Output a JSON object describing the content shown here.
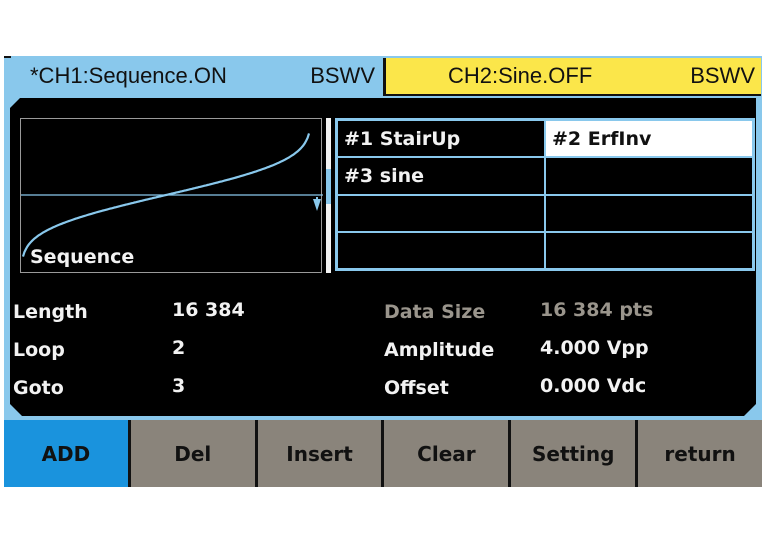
{
  "tabs": {
    "ch1": {
      "name": "*CH1:Sequence.ON",
      "mode": "BSWV"
    },
    "ch2": {
      "name": "CH2:Sine.OFF",
      "mode": "BSWV"
    }
  },
  "waveform": {
    "label": "Sequence",
    "shape": "inverse-error-function",
    "color": "#89c8ec"
  },
  "sequence_table": {
    "cells": [
      "#1 StairUp",
      "#2 ErfInv",
      "#3 sine",
      "",
      "",
      "",
      "",
      ""
    ],
    "selected_index": 1
  },
  "params_left": [
    {
      "label": "Length",
      "value": "16 384"
    },
    {
      "label": "Loop",
      "value": "2"
    },
    {
      "label": "Goto",
      "value": "3"
    }
  ],
  "params_right": [
    {
      "label": "Data Size",
      "value": "16 384 pts",
      "dimmed": true
    },
    {
      "label": "Amplitude",
      "value": "4.000 Vpp"
    },
    {
      "label": "Offset",
      "value": "0.000 Vdc"
    }
  ],
  "softkeys": [
    {
      "label": "ADD",
      "active": true
    },
    {
      "label": "Del"
    },
    {
      "label": "Insert"
    },
    {
      "label": "Clear"
    },
    {
      "label": "Setting"
    },
    {
      "label": "return"
    }
  ],
  "colors": {
    "ch1_tab": "#89c8ec",
    "ch2_tab": "#fbe64a",
    "active_softkey": "#1a93dd",
    "softkey": "#8a847b"
  }
}
